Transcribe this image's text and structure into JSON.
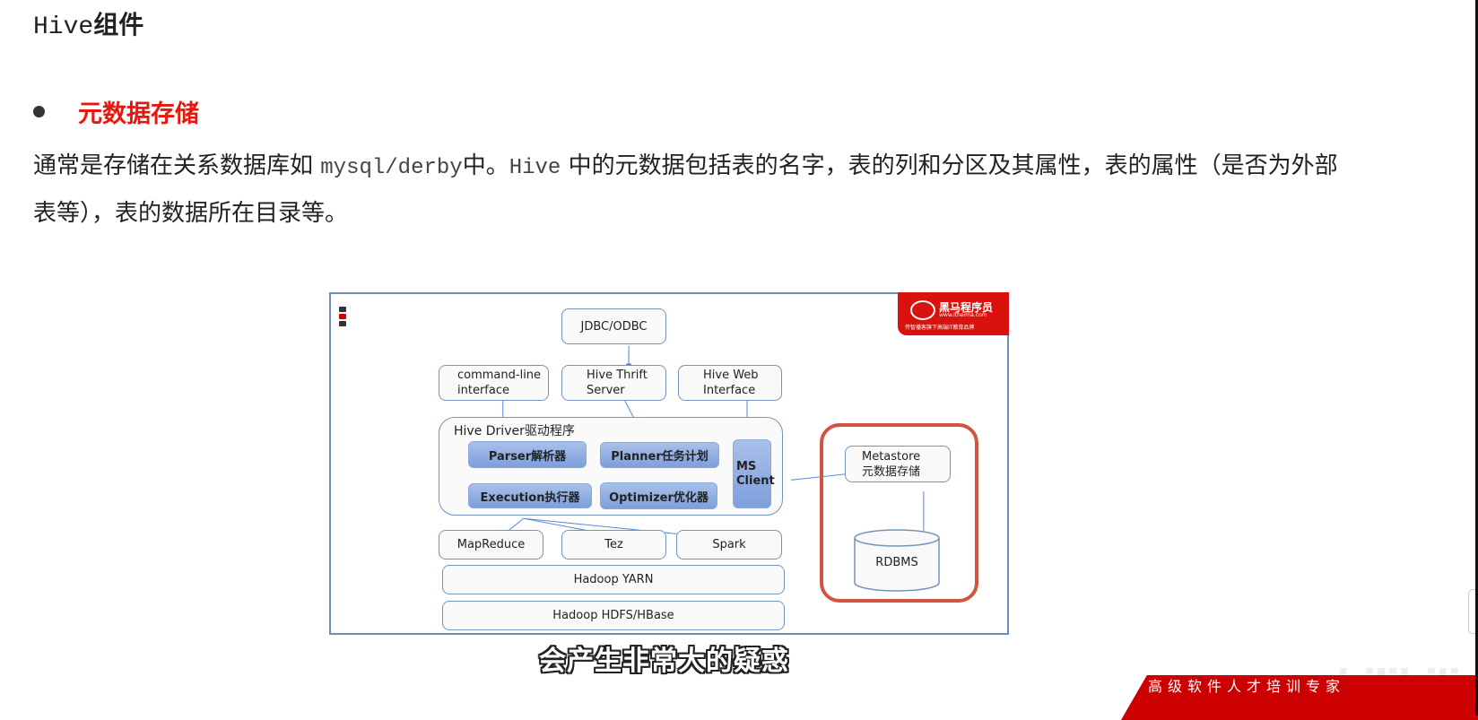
{
  "page": {
    "title_latin": "Hive",
    "title_cjk": "组件",
    "bullet_heading": "元数据存储",
    "paragraph": {
      "part1": "通常是存储在关系数据库如 ",
      "code1": "mysql/derby",
      "part2": "中。",
      "code2": "Hive",
      "part3": " 中的元数据包括表的名字，表的列和分区及其属性，表的属性（是否为外部表等），表的数据所在目录等。"
    },
    "accent_color": "#e8170d"
  },
  "diagram": {
    "logo": {
      "name": "黑马程序员",
      "url": "www.itheima.com",
      "slogan": "传智播客旗下高端IT教育品牌"
    },
    "nodes": {
      "jdbc": "JDBC/ODBC",
      "cli_line1": "command-line",
      "cli_line2": "interface",
      "thrift_line1": "Hive Thrift",
      "thrift_line2": "Server",
      "web_line1": "Hive Web",
      "web_line2": "Interface",
      "driver": "Hive Driver驱动程序",
      "parser": "Parser解析器",
      "planner": "Planner任务计划",
      "execution": "Execution执行器",
      "optimizer": "Optimizer优化器",
      "ms_client_line1": "MS",
      "ms_client_line2": "Client",
      "mapreduce": "MapReduce",
      "tez": "Tez",
      "spark": "Spark",
      "yarn": "Hadoop YARN",
      "hdfs": "Hadoop HDFS/HBase",
      "metastore_line1": "Metastore",
      "metastore_line2": "元数据存储",
      "rdbms": "RDBMS"
    },
    "highlight_color": "#d2533f"
  },
  "video_overlay": {
    "subtitle": "会产生非常大的疑惑",
    "watermark": "bilibili",
    "banner_text": "高级软件人才培训专家"
  }
}
